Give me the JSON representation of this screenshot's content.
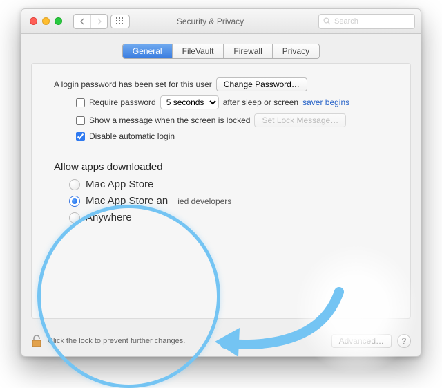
{
  "window": {
    "title": "Security & Privacy"
  },
  "search": {
    "placeholder": "Search"
  },
  "tabs": [
    {
      "label": "General",
      "selected": true
    },
    {
      "label": "FileVault",
      "selected": false
    },
    {
      "label": "Firewall",
      "selected": false
    },
    {
      "label": "Privacy",
      "selected": false
    }
  ],
  "login": {
    "password_set_text": "A login password has been set for this user",
    "change_password_label": "Change Password…",
    "require_label_pre": "Require password",
    "require_delay_value": "5 seconds",
    "require_label_post": "after sleep or screen",
    "require_link": "saver begins",
    "require_checked": false,
    "show_message_label": "Show a message when the screen is locked",
    "show_message_checked": false,
    "set_lock_message_label": "Set Lock Message…",
    "disable_auto_login_label": "Disable automatic login",
    "disable_auto_login_checked": true
  },
  "allow": {
    "title": "Allow apps downloaded from:",
    "full_title_truncated": "Allow apps downloaded",
    "options": [
      {
        "label": "Mac App Store",
        "selected": false
      },
      {
        "label": "Mac App Store and identified developers",
        "label_truncated": "Mac App Store an",
        "tail": "ied developers",
        "selected": true
      },
      {
        "label": "Anywhere",
        "selected": false
      }
    ]
  },
  "footer": {
    "lock_text": "Click the lock to prevent further changes.",
    "advanced_label": "Advanced…",
    "help_label": "?"
  },
  "colors": {
    "tab_selected": "#3a7de0",
    "annotation": "#74c4f3",
    "link": "#2763c8"
  }
}
